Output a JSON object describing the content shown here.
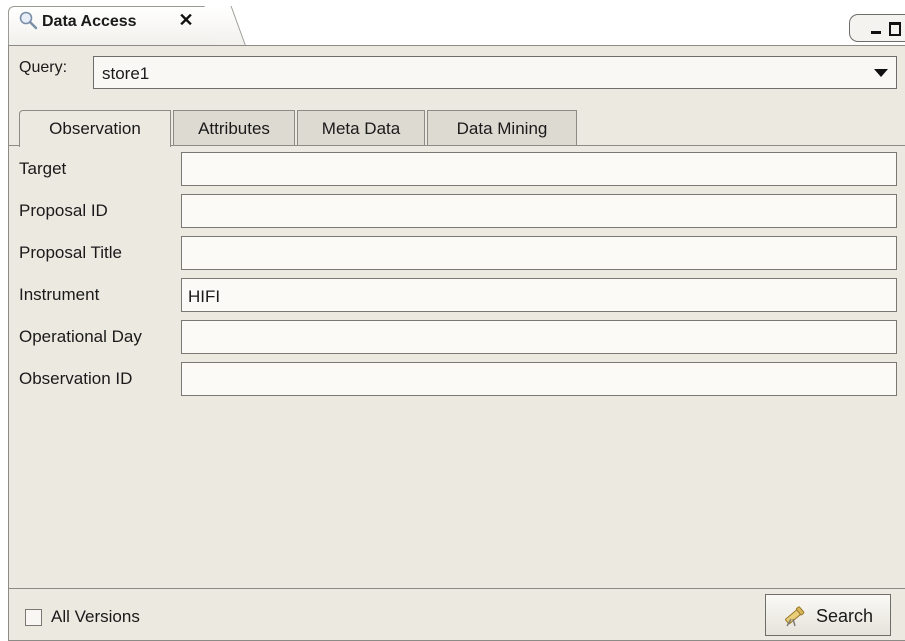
{
  "view_tab": {
    "title": "Data Access",
    "close_glyph": "✕",
    "icon": "magnifier-icon"
  },
  "window_controls": [
    "minimize-icon",
    "maximize-icon"
  ],
  "query": {
    "label": "Query:",
    "selected": "store1"
  },
  "tabs": [
    {
      "label": "Observation",
      "active": true
    },
    {
      "label": "Attributes",
      "active": false
    },
    {
      "label": "Meta Data",
      "active": false
    },
    {
      "label": "Data Mining",
      "active": false
    }
  ],
  "fields": [
    {
      "label": "Target",
      "value": ""
    },
    {
      "label": "Proposal ID",
      "value": ""
    },
    {
      "label": "Proposal Title",
      "value": ""
    },
    {
      "label": "Instrument",
      "value": "HIFI"
    },
    {
      "label": "Operational Day",
      "value": ""
    },
    {
      "label": "Observation ID",
      "value": ""
    }
  ],
  "footer": {
    "all_versions_label": "All Versions",
    "all_versions_checked": false,
    "search_label": "Search",
    "search_icon": "telescope-icon"
  },
  "colors": {
    "panel_bg": "#ece9e1",
    "border": "#8d8b85"
  }
}
